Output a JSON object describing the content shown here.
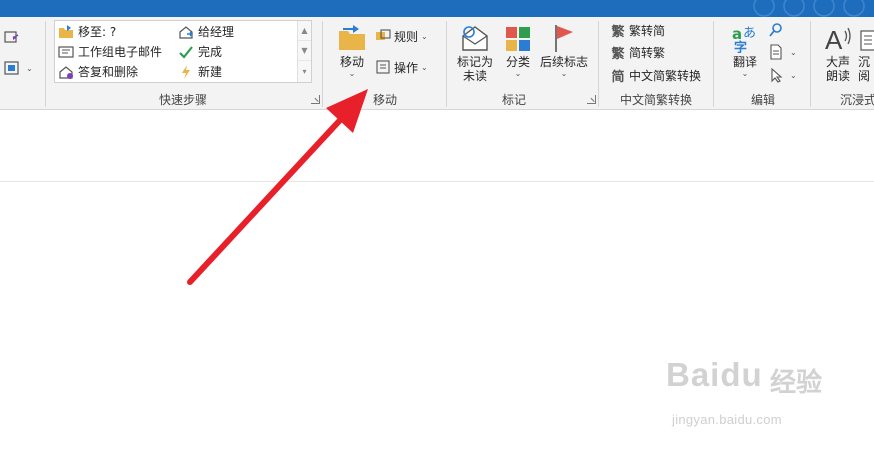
{
  "ribbon": {
    "quick_steps": {
      "items": [
        {
          "label": "移至: ?",
          "icon": "folder-move-icon"
        },
        {
          "label": "工作组电子邮件",
          "icon": "team-email-icon"
        },
        {
          "label": "答复和删除",
          "icon": "reply-delete-icon"
        },
        {
          "label": "给经理",
          "icon": "to-manager-icon"
        },
        {
          "label": "完成",
          "icon": "checkmark-icon"
        },
        {
          "label": "新建",
          "icon": "new-lightning-icon"
        }
      ],
      "group_label": "快速步骤"
    },
    "move": {
      "move_label": "移动",
      "rules_label": "规则",
      "actions_label": "操作",
      "group_label": "移动"
    },
    "tags": {
      "unread_label_line1": "标记为",
      "unread_label_line2": "未读",
      "categorize_label": "分类",
      "followup_label": "后续标志",
      "group_label": "标记"
    },
    "chinese_conversion": {
      "trad_to_simp": "繁转简",
      "simp_to_trad": "简转繁",
      "convert": "中文简繁转换",
      "group_label": "中文简繁转换"
    },
    "editing": {
      "translate_label": "翻译",
      "group_label": "编辑"
    },
    "immersive": {
      "read_aloud_line1": "大声",
      "read_aloud_line2": "朗读",
      "immersive_partial_line1": "沉",
      "immersive_partial_line2": "阅",
      "group_label": "沉浸式"
    }
  },
  "watermark": {
    "brand": "Baidu",
    "brand_cn": "经验",
    "url": "jingyan.baidu.com"
  },
  "colors": {
    "titlebar": "#1e6dbd",
    "ribbon_bg": "#f3f3f3",
    "arrow": "#e8202a",
    "flag": "#e2574c"
  }
}
